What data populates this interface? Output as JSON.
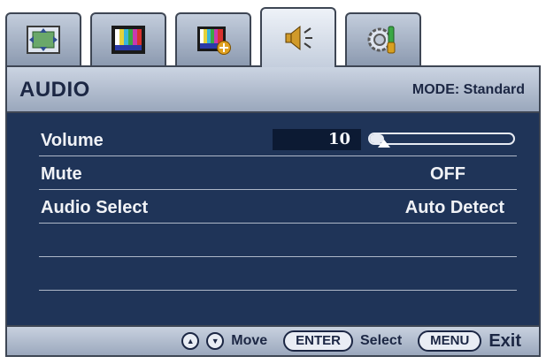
{
  "tabs": [
    {
      "name": "display-tab",
      "icon": "display-settings-icon",
      "active": false
    },
    {
      "name": "picture-tab",
      "icon": "picture-icon",
      "active": false
    },
    {
      "name": "picture-advanced-tab",
      "icon": "picture-advanced-icon",
      "active": false
    },
    {
      "name": "audio-tab",
      "icon": "speaker-icon",
      "active": true
    },
    {
      "name": "system-tab",
      "icon": "system-settings-icon",
      "active": false
    }
  ],
  "header": {
    "title": "AUDIO",
    "mode": "MODE: Standard"
  },
  "menu": {
    "volume": {
      "label": "Volume",
      "value": "10",
      "level_percent": 10
    },
    "mute": {
      "label": "Mute",
      "value": "OFF"
    },
    "audio_select": {
      "label": "Audio Select",
      "value": "Auto Detect"
    }
  },
  "footer": {
    "up_icon": "up-arrow-icon",
    "down_icon": "down-arrow-icon",
    "move_label": "Move",
    "enter_key": "ENTER",
    "select_label": "Select",
    "menu_key": "MENU",
    "exit_label": "Exit"
  },
  "colors": {
    "panel_bg": "#1f3458",
    "header_bg": "#b4bfd0",
    "text_light": "#f0f2f6",
    "text_dark": "#1c2744"
  }
}
